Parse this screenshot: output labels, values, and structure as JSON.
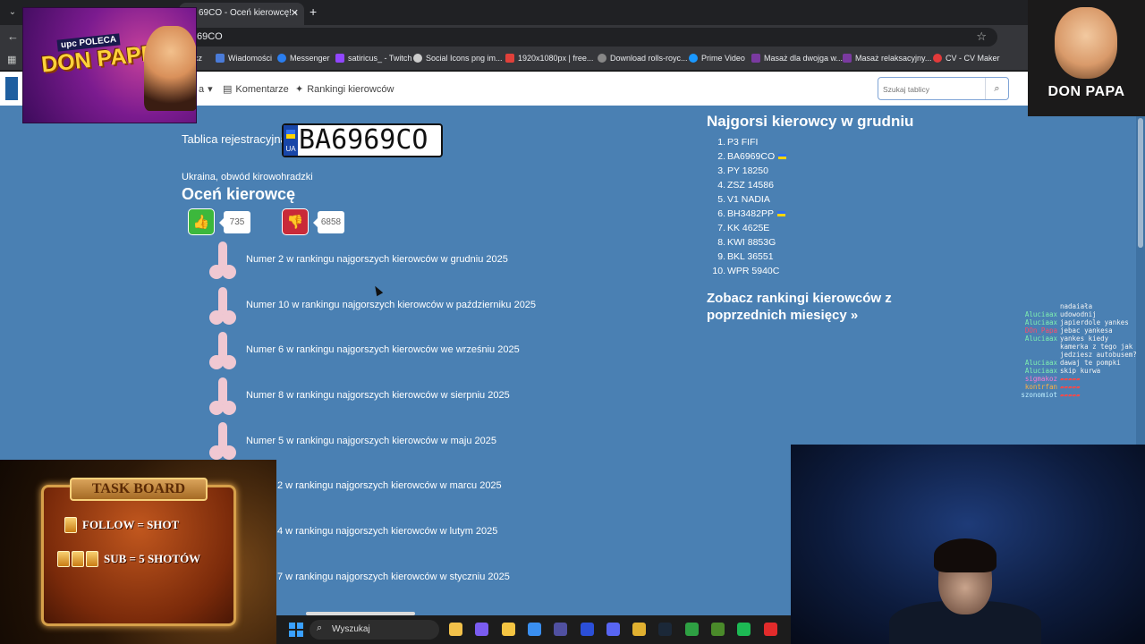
{
  "browser": {
    "tab_title": "69CO - Oceń kierowcę! - ",
    "tab_close": "✕",
    "new_tab": "+",
    "url": "69CO",
    "bookmarks": [
      {
        "label": "ącz",
        "color": "#6b6b6b"
      },
      {
        "label": "Wiadomości",
        "color": "#4a7bd8"
      },
      {
        "label": "Messenger",
        "color": "#2a7ef0"
      },
      {
        "label": "satiricus_ - Twitch",
        "color": "#9146ff"
      },
      {
        "label": "Social Icons png im...",
        "color": "#cccccc"
      },
      {
        "label": "1920x1080px | free...",
        "color": "#e0403a"
      },
      {
        "label": "Download rolls-royc...",
        "color": "#888888"
      },
      {
        "label": "Prime Video",
        "color": "#1a98ff"
      },
      {
        "label": "Masaż dla dwojga w...",
        "color": "#7a3aa0"
      },
      {
        "label": "Masaż relaksacyjny...",
        "color": "#7a3aa0"
      },
      {
        "label": "CV - CV Maker",
        "color": "#e23a3a"
      }
    ]
  },
  "site": {
    "nav": [
      {
        "label": "a",
        "icon": "chevron-down-icon",
        "glyph": "▾"
      },
      {
        "label": "Komentarze",
        "icon": "comment-icon",
        "glyph": "▤"
      },
      {
        "label": "Rankingi kierowców",
        "icon": "sparkle-icon",
        "glyph": "✦"
      }
    ],
    "search": {
      "placeholder": "Szukaj tablicy",
      "value": ""
    },
    "plate_label": "Tablica rejestracyjna",
    "plate_number": "BA6969CO",
    "plate_country": "UA",
    "region": "Ukraina, obwód kirowohradzki",
    "rate_title": "Oceń kierowcę",
    "votes_up": "735",
    "votes_down": "6858",
    "rankings": [
      "Numer 2 w rankingu najgorszych kierowców w grudniu 2025",
      "Numer 10 w rankingu najgorszych kierowców w październiku 2025",
      "Numer 6 w rankingu najgorszych kierowców we wrześniu 2025",
      "Numer 8 w rankingu najgorszych kierowców w sierpniu 2025",
      "Numer 5 w rankingu najgorszych kierowców w maju 2025",
      "2 w rankingu najgorszych kierowców w marcu 2025",
      "4 w rankingu najgorszych kierowców w lutym 2025",
      "7 w rankingu najgorszych kierowców w styczniu 2025"
    ],
    "worst_title": "Najgorsi kierowcy w grudniu",
    "worst_list": [
      {
        "n": "1.",
        "plate": "P3 FIFI",
        "flag": false
      },
      {
        "n": "2.",
        "plate": "BA6969CO",
        "flag": true
      },
      {
        "n": "3.",
        "plate": "PY 18250",
        "flag": false
      },
      {
        "n": "4.",
        "plate": "ZSZ 14586",
        "flag": false
      },
      {
        "n": "5.",
        "plate": "V1 NADIA",
        "flag": false
      },
      {
        "n": "6.",
        "plate": "BH3482PP",
        "flag": true
      },
      {
        "n": "7.",
        "plate": "KK 4625E",
        "flag": false
      },
      {
        "n": "8.",
        "plate": "KWI 8853G",
        "flag": false
      },
      {
        "n": "9.",
        "plate": "BKL 36551",
        "flag": false
      },
      {
        "n": "10.",
        "plate": "WPR 5940C",
        "flag": false
      }
    ],
    "prev_link": "Zobacz rankingi kierowców z poprzednich miesięcy »"
  },
  "overlays": {
    "ad_upc": "upc POLECA",
    "ad_title": "DON PAPE",
    "logo_text": "DON PAPA",
    "taskboard_title": "TASK BOARD",
    "taskboard_rows": [
      "FOLLOW = SHOT",
      "SUB = 5 SHOTÓW"
    ],
    "chat": [
      {
        "user": "",
        "text": "nadaiała",
        "color": "#ffffff"
      },
      {
        "user": "Aluciaax",
        "text": "udowodnij",
        "color": "#7ff0b0"
      },
      {
        "user": "Aluciaax",
        "text": "japierdole yankes",
        "color": "#7ff0b0"
      },
      {
        "user": "DOn_Papa",
        "text": "jebac yankesa",
        "color": "#ff4a6a"
      },
      {
        "user": "Aluciaax",
        "text": "yankes kiedy kamerka z tego jak jedziesz autobusem?",
        "color": "#7ff0b0"
      },
      {
        "user": "Aluciaax",
        "text": "dawaj te pompki",
        "color": "#7ff0b0"
      },
      {
        "user": "Aluciaax",
        "text": "skip kurwa",
        "color": "#7ff0b0"
      },
      {
        "user": "sigmakoz",
        "text": "",
        "color": "#ff7ad0"
      },
      {
        "user": "kontrfan",
        "text": "",
        "color": "#ffb040"
      },
      {
        "user": "szonomiot",
        "text": "",
        "color": "#c0f0ff"
      }
    ]
  },
  "taskbar": {
    "search_label": "Wyszukaj",
    "apps": [
      {
        "name": "file-explorer-icon",
        "color": "#f2c14a"
      },
      {
        "name": "copilot-icon",
        "color": "#7a5cf0"
      },
      {
        "name": "folder-icon",
        "color": "#f5c542"
      },
      {
        "name": "store-icon",
        "color": "#3a8ff0"
      },
      {
        "name": "obs-icon",
        "color": "#5050a0"
      },
      {
        "name": "l-app-icon",
        "color": "#2b4fd8"
      },
      {
        "name": "discord-icon",
        "color": "#5865f2"
      },
      {
        "name": "chrome-icon",
        "color": "#e0b030"
      },
      {
        "name": "steam-icon",
        "color": "#1b2838"
      },
      {
        "name": "xbox-icon",
        "color": "#2ea043"
      },
      {
        "name": "minecraft-icon",
        "color": "#4a8a2a"
      },
      {
        "name": "spotify-icon",
        "color": "#1db954"
      },
      {
        "name": "opera-icon",
        "color": "#e22b2b"
      }
    ]
  }
}
